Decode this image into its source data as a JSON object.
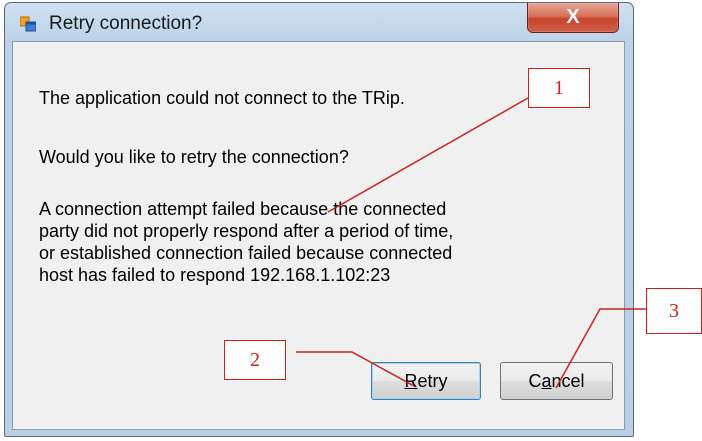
{
  "dialog": {
    "title": "Retry connection?",
    "close_label": "X",
    "message_1": "The application could not connect to the TRip.",
    "message_2": "Would you like to retry the connection?",
    "message_3": "A connection attempt failed because the connected party did not properly respond after a period of time, or established connection failed because connected host has failed to respond 192.168.1.102:23",
    "retry_mnemonic": "R",
    "retry_rest": "etry",
    "cancel_prefix": "C",
    "cancel_mnemonic": "a",
    "cancel_rest": "ncel"
  },
  "annotations": {
    "callout_1": "1",
    "callout_2": "2",
    "callout_3": "3",
    "color": "#d0201a"
  },
  "icons": {
    "app_icon": "application-window-icon",
    "close_icon": "close-icon"
  }
}
